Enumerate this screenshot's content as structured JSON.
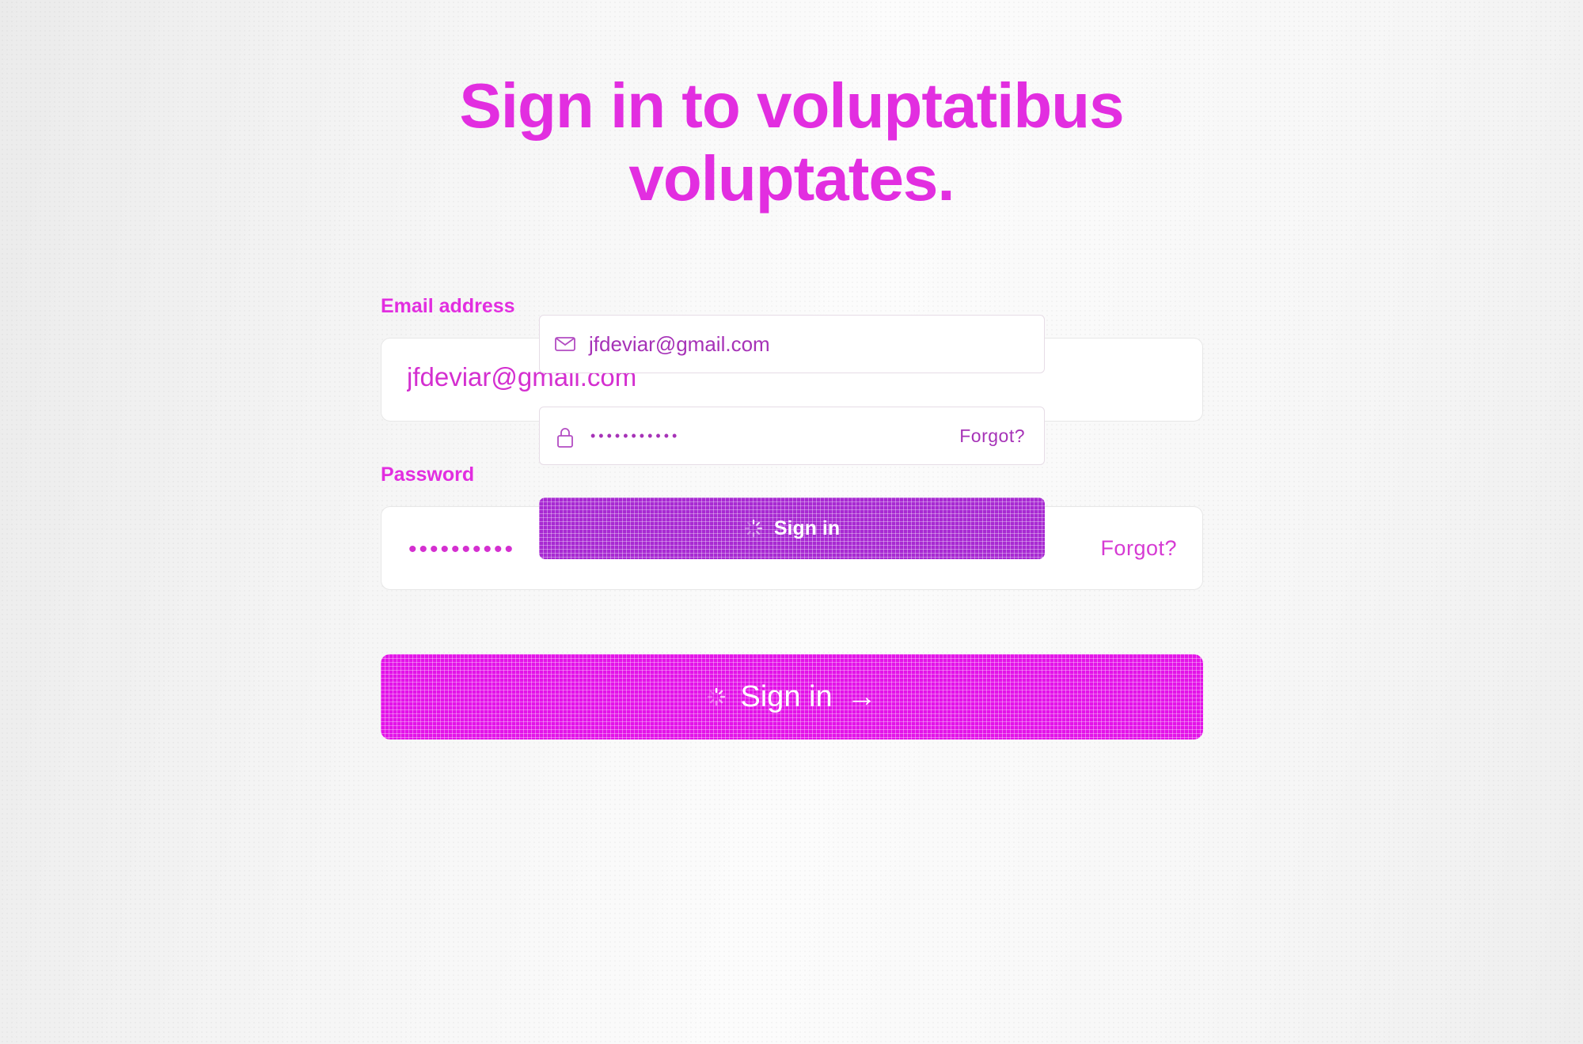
{
  "page": {
    "heading": "Sign in to voluptatibus voluptates."
  },
  "form": {
    "email_label": "Email address",
    "email_value": "jfdeviar@gmail.com",
    "password_label": "Password",
    "password_mask": "••••••••••",
    "forgot_link": "Forgot?",
    "submit_label": "Sign in",
    "submit_arrow": "→"
  },
  "overlay_card": {
    "email_value": "jfdeviar@gmail.com",
    "password_mask": "•••••••••••",
    "forgot_link": "Forgot?",
    "submit_label": "Sign in"
  },
  "icons": {
    "email": "mail-icon",
    "password": "lock-icon",
    "loading": "spinner-icon",
    "arrow": "arrow-right-icon"
  },
  "colors": {
    "accent": "#e313e8",
    "accent_text": "#e22ee0",
    "overlay_button": "#a82ad2",
    "overlay_text": "#a632b7"
  }
}
